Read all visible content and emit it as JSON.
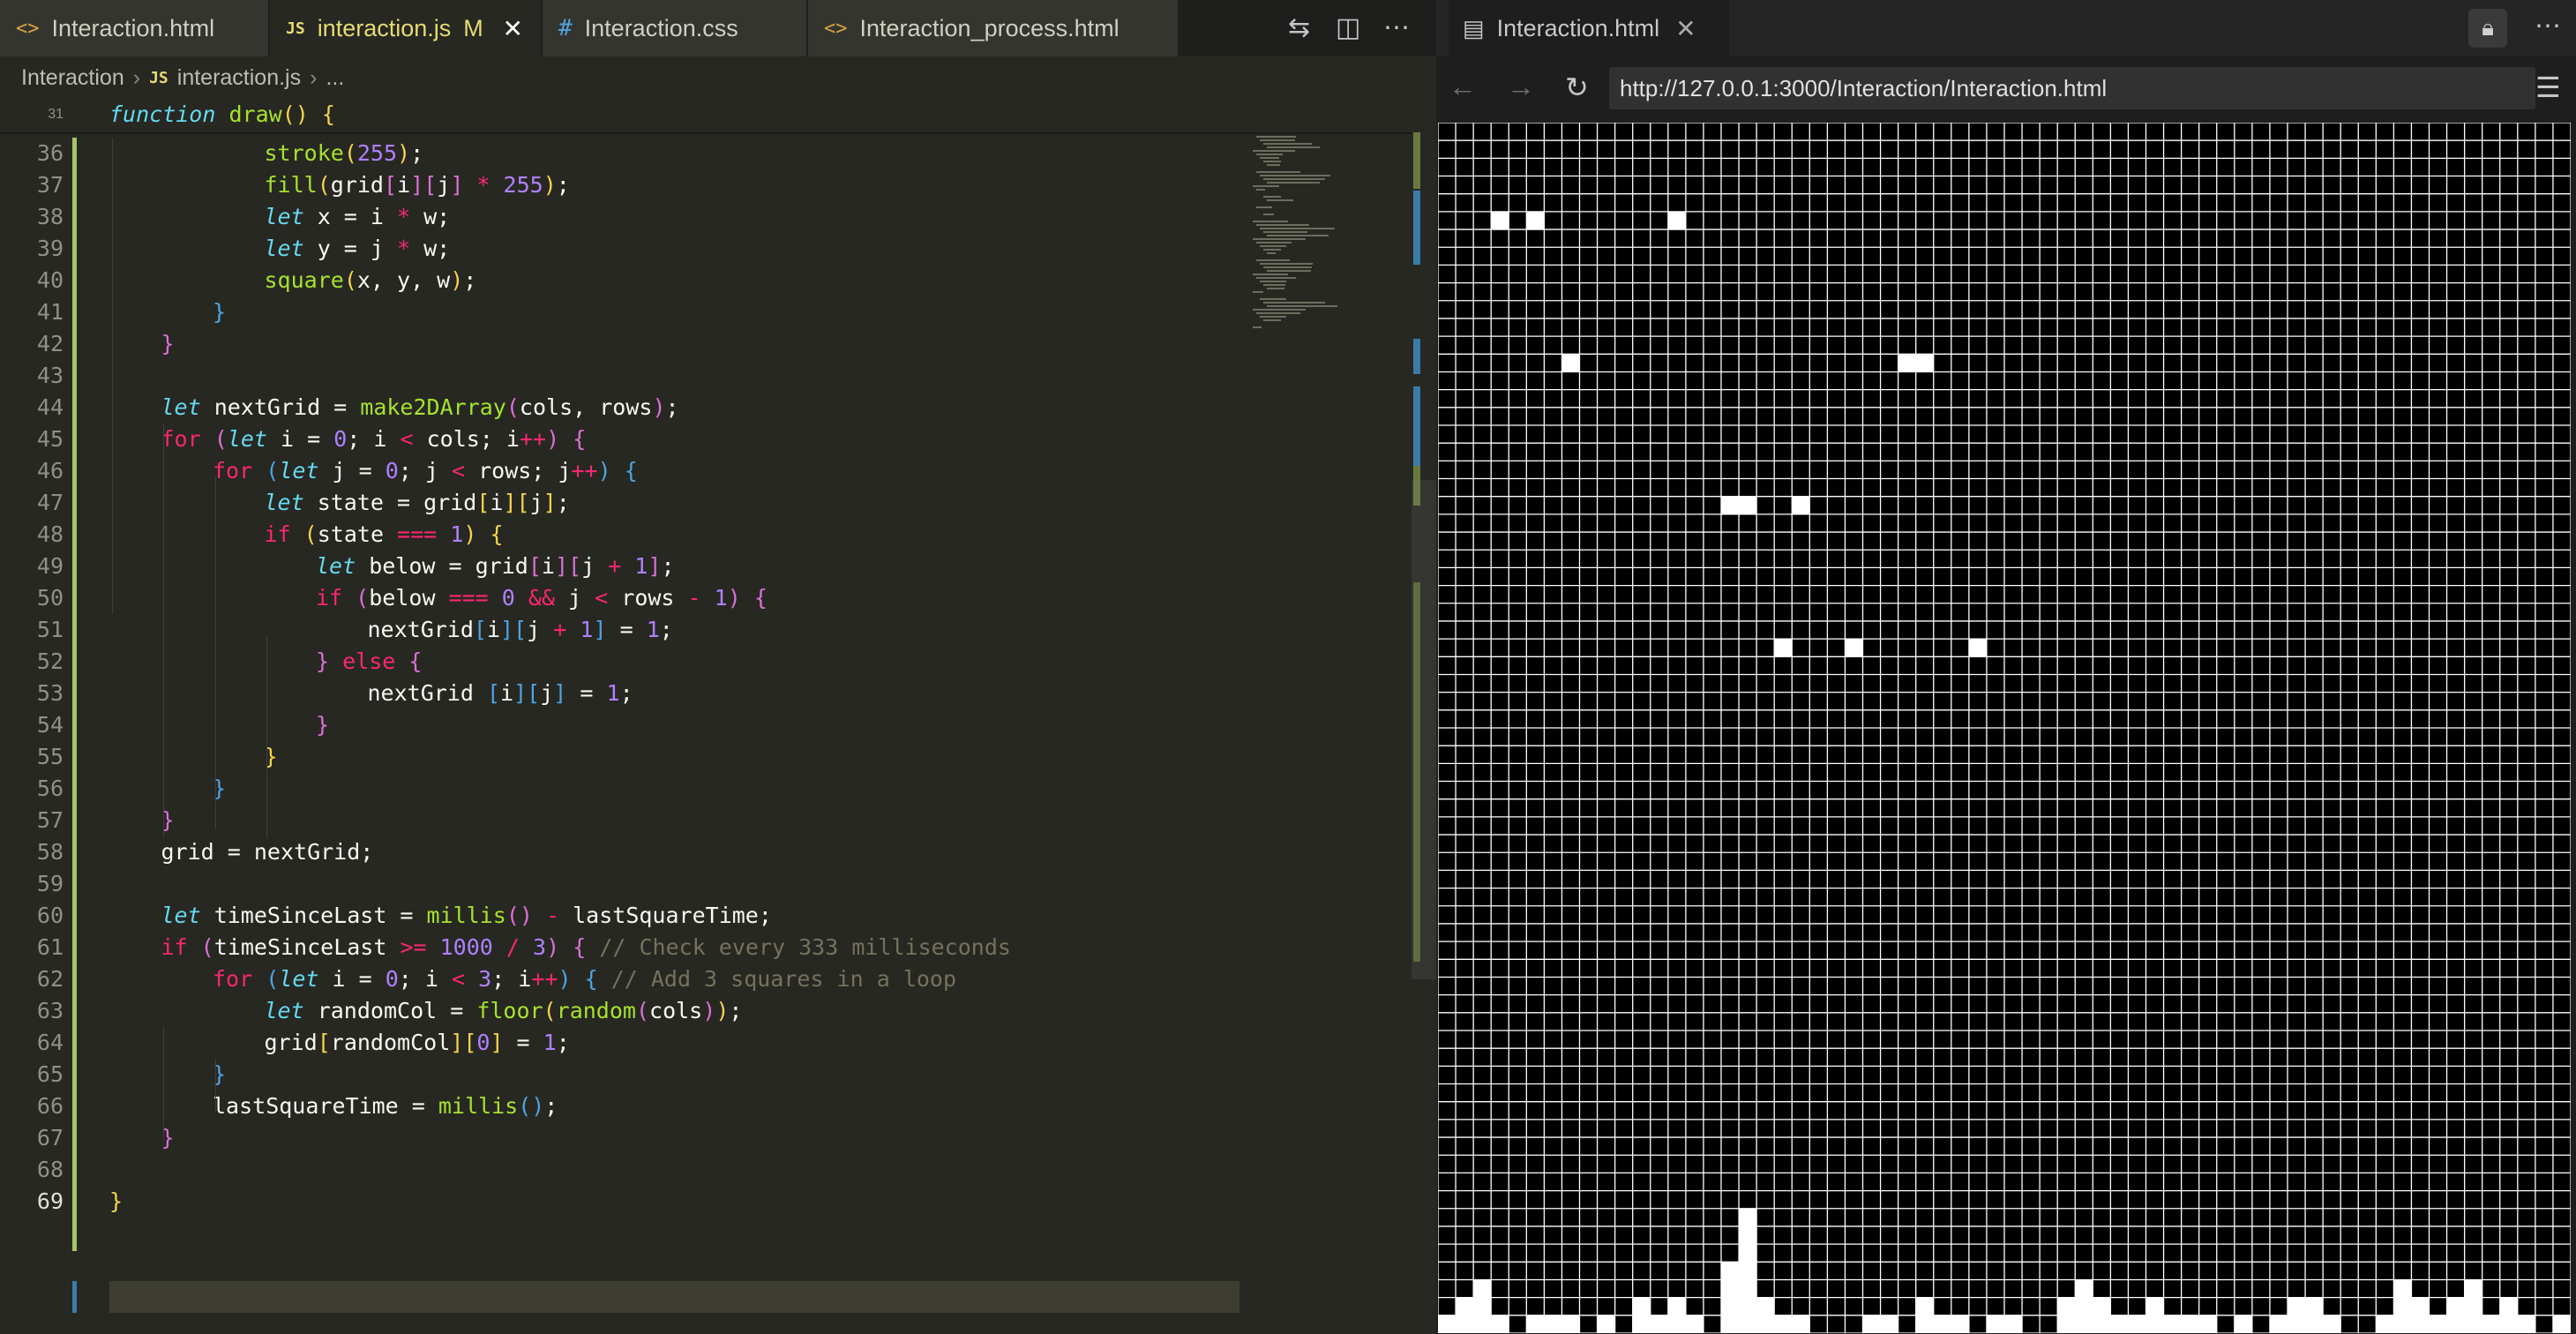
{
  "editor": {
    "tabs": [
      {
        "label": "Interaction.html",
        "icon": "html-file-icon",
        "active": false,
        "modified": ""
      },
      {
        "label": "interaction.js",
        "icon": "js-file-icon",
        "active": true,
        "modified": "M"
      },
      {
        "label": "Interaction.css",
        "icon": "css-file-icon",
        "active": false,
        "modified": ""
      },
      {
        "label": "Interaction_process.html",
        "icon": "html-file-icon",
        "active": false,
        "modified": ""
      }
    ],
    "toolbar_icons": [
      "compare-changes-icon",
      "split-editor-icon",
      "more-actions-icon"
    ],
    "breadcrumb": {
      "folder": "Interaction",
      "js_badge": "JS",
      "file": "interaction.js",
      "symbol": "..."
    },
    "sticky_line": {
      "number": "31",
      "text": "function draw() {"
    },
    "current_line": "69",
    "lines": [
      {
        "n": "36",
        "i": 3,
        "t": [
          [
            "fn",
            "stroke"
          ],
          [
            "br1",
            "("
          ],
          [
            "num",
            "255"
          ],
          [
            "br1",
            ")"
          ],
          [
            "",
            ";"
          ]
        ]
      },
      {
        "n": "37",
        "i": 3,
        "t": [
          [
            "fn",
            "fill"
          ],
          [
            "br1",
            "("
          ],
          [
            "",
            "grid"
          ],
          [
            "br2",
            "["
          ],
          [
            "",
            "i"
          ],
          [
            "br2",
            "]"
          ],
          [
            "br2",
            "["
          ],
          [
            "",
            "j"
          ],
          [
            "br2",
            "]"
          ],
          [
            "op",
            " * "
          ],
          [
            "num",
            "255"
          ],
          [
            "br1",
            ")"
          ],
          [
            "",
            ";"
          ]
        ]
      },
      {
        "n": "38",
        "i": 3,
        "t": [
          [
            "kw",
            "let"
          ],
          [
            "",
            " x = i "
          ],
          [
            "op",
            "*"
          ],
          [
            "",
            " w;"
          ]
        ]
      },
      {
        "n": "39",
        "i": 3,
        "t": [
          [
            "kw",
            "let"
          ],
          [
            "",
            " y = j "
          ],
          [
            "op",
            "*"
          ],
          [
            "",
            " w;"
          ]
        ]
      },
      {
        "n": "40",
        "i": 3,
        "t": [
          [
            "fn",
            "square"
          ],
          [
            "br1",
            "("
          ],
          [
            "",
            "x, y, w"
          ],
          [
            "br1",
            ")"
          ],
          [
            "",
            ";"
          ]
        ]
      },
      {
        "n": "41",
        "i": 2,
        "t": [
          [
            "br3",
            "}"
          ]
        ]
      },
      {
        "n": "42",
        "i": 1,
        "t": [
          [
            "br2",
            "}"
          ]
        ]
      },
      {
        "n": "43",
        "i": 0,
        "t": []
      },
      {
        "n": "44",
        "i": 1,
        "t": [
          [
            "kw",
            "let"
          ],
          [
            "",
            " nextGrid = "
          ],
          [
            "fn",
            "make2DArray"
          ],
          [
            "br2",
            "("
          ],
          [
            "",
            "cols, rows"
          ],
          [
            "br2",
            ")"
          ],
          [
            "",
            ";"
          ]
        ]
      },
      {
        "n": "45",
        "i": 1,
        "t": [
          [
            "kwp",
            "for"
          ],
          [
            "",
            " "
          ],
          [
            "br2",
            "("
          ],
          [
            "kw",
            "let"
          ],
          [
            "",
            " i = "
          ],
          [
            "num",
            "0"
          ],
          [
            "",
            "; i "
          ],
          [
            "op",
            "<"
          ],
          [
            "",
            " cols; i"
          ],
          [
            "op",
            "++"
          ],
          [
            "br2",
            ")"
          ],
          [
            "",
            " "
          ],
          [
            "br2",
            "{"
          ]
        ]
      },
      {
        "n": "46",
        "i": 2,
        "t": [
          [
            "kwp",
            "for"
          ],
          [
            "",
            " "
          ],
          [
            "br3",
            "("
          ],
          [
            "kw",
            "let"
          ],
          [
            "",
            " j = "
          ],
          [
            "num",
            "0"
          ],
          [
            "",
            "; j "
          ],
          [
            "op",
            "<"
          ],
          [
            "",
            " rows; j"
          ],
          [
            "op",
            "++"
          ],
          [
            "br3",
            ")"
          ],
          [
            "",
            " "
          ],
          [
            "br3",
            "{"
          ]
        ]
      },
      {
        "n": "47",
        "i": 3,
        "t": [
          [
            "kw",
            "let"
          ],
          [
            "",
            " state = grid"
          ],
          [
            "br1",
            "["
          ],
          [
            "",
            "i"
          ],
          [
            "br1",
            "]"
          ],
          [
            "br1",
            "["
          ],
          [
            "",
            "j"
          ],
          [
            "br1",
            "]"
          ],
          [
            "",
            ";"
          ]
        ]
      },
      {
        "n": "48",
        "i": 3,
        "t": [
          [
            "kwp",
            "if"
          ],
          [
            "",
            " "
          ],
          [
            "br1",
            "("
          ],
          [
            "",
            "state "
          ],
          [
            "op",
            "==="
          ],
          [
            "",
            " "
          ],
          [
            "num",
            "1"
          ],
          [
            "br1",
            ")"
          ],
          [
            "",
            " "
          ],
          [
            "br1",
            "{"
          ]
        ]
      },
      {
        "n": "49",
        "i": 4,
        "t": [
          [
            "kw",
            "let"
          ],
          [
            "",
            " below = grid"
          ],
          [
            "br2",
            "["
          ],
          [
            "",
            "i"
          ],
          [
            "br2",
            "]"
          ],
          [
            "br2",
            "["
          ],
          [
            "",
            "j "
          ],
          [
            "op",
            "+"
          ],
          [
            "",
            " "
          ],
          [
            "num",
            "1"
          ],
          [
            "br2",
            "]"
          ],
          [
            "",
            ";"
          ]
        ]
      },
      {
        "n": "50",
        "i": 4,
        "t": [
          [
            "kwp",
            "if"
          ],
          [
            "",
            " "
          ],
          [
            "br2",
            "("
          ],
          [
            "",
            "below "
          ],
          [
            "op",
            "==="
          ],
          [
            "",
            " "
          ],
          [
            "num",
            "0"
          ],
          [
            "",
            " "
          ],
          [
            "op",
            "&&"
          ],
          [
            "",
            " j "
          ],
          [
            "op",
            "<"
          ],
          [
            "",
            " rows "
          ],
          [
            "op",
            "-"
          ],
          [
            "",
            " "
          ],
          [
            "num",
            "1"
          ],
          [
            "br2",
            ")"
          ],
          [
            "",
            " "
          ],
          [
            "br2",
            "{"
          ]
        ]
      },
      {
        "n": "51",
        "i": 5,
        "t": [
          [
            "",
            "nextGrid"
          ],
          [
            "br3",
            "["
          ],
          [
            "",
            "i"
          ],
          [
            "br3",
            "]"
          ],
          [
            "br3",
            "["
          ],
          [
            "",
            "j "
          ],
          [
            "op",
            "+"
          ],
          [
            "",
            " "
          ],
          [
            "num",
            "1"
          ],
          [
            "br3",
            "]"
          ],
          [
            "",
            " = "
          ],
          [
            "num",
            "1"
          ],
          [
            "",
            ";"
          ]
        ]
      },
      {
        "n": "52",
        "i": 4,
        "t": [
          [
            "br2",
            "}"
          ],
          [
            "",
            " "
          ],
          [
            "kwp",
            "else"
          ],
          [
            "",
            " "
          ],
          [
            "br2",
            "{"
          ]
        ]
      },
      {
        "n": "53",
        "i": 5,
        "t": [
          [
            "",
            "nextGrid "
          ],
          [
            "br3",
            "["
          ],
          [
            "",
            "i"
          ],
          [
            "br3",
            "]"
          ],
          [
            "br3",
            "["
          ],
          [
            "",
            "j"
          ],
          [
            "br3",
            "]"
          ],
          [
            "",
            " = "
          ],
          [
            "num",
            "1"
          ],
          [
            "",
            ";"
          ]
        ]
      },
      {
        "n": "54",
        "i": 4,
        "t": [
          [
            "br2",
            "}"
          ]
        ]
      },
      {
        "n": "55",
        "i": 3,
        "t": [
          [
            "br1",
            "}"
          ]
        ]
      },
      {
        "n": "56",
        "i": 2,
        "t": [
          [
            "br3",
            "}"
          ]
        ]
      },
      {
        "n": "57",
        "i": 1,
        "t": [
          [
            "br2",
            "}"
          ]
        ]
      },
      {
        "n": "58",
        "i": 1,
        "t": [
          [
            "",
            "grid = nextGrid;"
          ]
        ]
      },
      {
        "n": "59",
        "i": 0,
        "t": []
      },
      {
        "n": "60",
        "i": 1,
        "t": [
          [
            "kw",
            "let"
          ],
          [
            "",
            " timeSinceLast = "
          ],
          [
            "fn",
            "millis"
          ],
          [
            "br2",
            "()"
          ],
          [
            "",
            " "
          ],
          [
            "op",
            "-"
          ],
          [
            "",
            " lastSquareTime;"
          ]
        ]
      },
      {
        "n": "61",
        "i": 1,
        "t": [
          [
            "kwp",
            "if"
          ],
          [
            "",
            " "
          ],
          [
            "br2",
            "("
          ],
          [
            "",
            "timeSinceLast "
          ],
          [
            "op",
            ">="
          ],
          [
            "",
            " "
          ],
          [
            "num",
            "1000"
          ],
          [
            "",
            " "
          ],
          [
            "op",
            "/"
          ],
          [
            "",
            " "
          ],
          [
            "num",
            "3"
          ],
          [
            "br2",
            ")"
          ],
          [
            "",
            " "
          ],
          [
            "br2",
            "{"
          ],
          [
            "",
            " "
          ],
          [
            "cm",
            "// Check every 333 milliseconds"
          ]
        ]
      },
      {
        "n": "62",
        "i": 2,
        "t": [
          [
            "kwp",
            "for"
          ],
          [
            "",
            " "
          ],
          [
            "br3",
            "("
          ],
          [
            "kw",
            "let"
          ],
          [
            "",
            " i = "
          ],
          [
            "num",
            "0"
          ],
          [
            "",
            "; i "
          ],
          [
            "op",
            "<"
          ],
          [
            "",
            " "
          ],
          [
            "num",
            "3"
          ],
          [
            "",
            "; i"
          ],
          [
            "op",
            "++"
          ],
          [
            "br3",
            ")"
          ],
          [
            "",
            " "
          ],
          [
            "br3",
            "{"
          ],
          [
            "",
            " "
          ],
          [
            "cm",
            "// Add 3 squares in a loop"
          ]
        ]
      },
      {
        "n": "63",
        "i": 3,
        "t": [
          [
            "kw",
            "let"
          ],
          [
            "",
            " randomCol = "
          ],
          [
            "fn",
            "floor"
          ],
          [
            "br1",
            "("
          ],
          [
            "fn",
            "random"
          ],
          [
            "br2",
            "("
          ],
          [
            "",
            "cols"
          ],
          [
            "br2",
            ")"
          ],
          [
            "br1",
            ")"
          ],
          [
            "",
            ";"
          ]
        ]
      },
      {
        "n": "64",
        "i": 3,
        "t": [
          [
            "",
            "grid"
          ],
          [
            "br1",
            "["
          ],
          [
            "",
            "randomCol"
          ],
          [
            "br1",
            "]"
          ],
          [
            "br1",
            "["
          ],
          [
            "num",
            "0"
          ],
          [
            "br1",
            "]"
          ],
          [
            "",
            " = "
          ],
          [
            "num",
            "1"
          ],
          [
            "",
            ";"
          ]
        ]
      },
      {
        "n": "65",
        "i": 2,
        "t": [
          [
            "br3",
            "}"
          ]
        ]
      },
      {
        "n": "66",
        "i": 2,
        "t": [
          [
            "",
            "lastSquareTime = "
          ],
          [
            "fn",
            "millis"
          ],
          [
            "br3",
            "()"
          ],
          [
            "",
            ";"
          ]
        ]
      },
      {
        "n": "67",
        "i": 1,
        "t": [
          [
            "br2",
            "}"
          ]
        ]
      },
      {
        "n": "68",
        "i": 0,
        "t": []
      },
      {
        "n": "69",
        "i": 0,
        "t": [
          [
            "br1",
            "}"
          ]
        ]
      }
    ]
  },
  "browser": {
    "tab_title": "Interaction.html",
    "url": "http://127.0.0.1:3000/Interaction/Interaction.html",
    "icons": [
      "preview-icon",
      "close-icon",
      "lock-icon",
      "more-actions-icon",
      "back-arrow-icon",
      "forward-arrow-icon",
      "reload-icon",
      "menu-icon"
    ],
    "sketch": {
      "cols": 64,
      "rows": 68,
      "cell_color_on": "#ffffff",
      "cell_color_off": "#000000",
      "grid_line_color": "#ffffff",
      "background_color": "#000000",
      "falling_cells": [
        [
          3,
          5
        ],
        [
          5,
          5
        ],
        [
          13,
          5
        ],
        [
          7,
          13
        ],
        [
          26,
          13
        ],
        [
          27,
          13
        ],
        [
          16,
          21
        ],
        [
          17,
          21
        ],
        [
          20,
          21
        ],
        [
          19,
          29
        ],
        [
          23,
          29
        ],
        [
          30,
          29
        ]
      ],
      "bottom_column_heights": [
        1,
        2,
        3,
        1,
        0,
        1,
        1,
        1,
        0,
        1,
        0,
        2,
        1,
        2,
        1,
        0,
        4,
        7,
        2,
        1,
        1,
        0,
        0,
        0,
        1,
        1,
        0,
        2,
        1,
        1,
        0,
        1,
        1,
        0,
        0,
        2,
        3,
        2,
        1,
        1,
        2,
        1,
        1,
        1,
        0,
        1,
        0,
        1,
        2,
        2,
        1,
        0,
        0,
        1,
        3,
        2,
        1,
        2,
        3,
        1,
        2,
        1,
        0,
        1
      ]
    }
  }
}
